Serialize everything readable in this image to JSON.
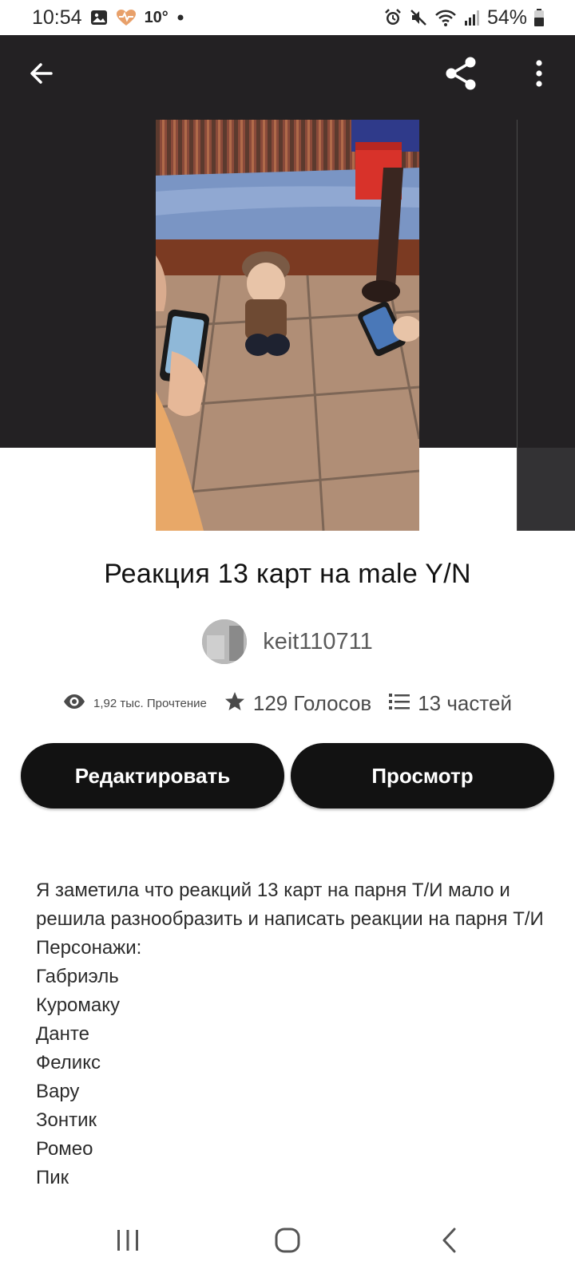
{
  "status_bar": {
    "time": "10:54",
    "temperature": "10°",
    "battery": "54%",
    "icons": [
      "image-icon",
      "health-icon",
      "dot-icon",
      "alarm-icon",
      "mute-icon",
      "wifi-icon",
      "signal-icon",
      "battery-icon"
    ]
  },
  "top_bar": {
    "back_icon": "arrow-left-icon",
    "share_icon": "share-icon",
    "more_icon": "more-vertical-icon"
  },
  "story": {
    "title": "Реакция 13 карт на male Y/N",
    "author": "keit110711",
    "stats": {
      "reads": "1,92 тыс. Прочтение",
      "votes": "129 Голосов",
      "parts": "13 частей"
    }
  },
  "buttons": {
    "edit_label": "Редактировать",
    "view_label": "Просмотр"
  },
  "description": {
    "intro": "Я заметила что реакций 13 карт на парня Т/И мало и решила разнообразить и написать реакции на парня Т/И",
    "lines": [
      "Персонажи:",
      "Габриэль",
      "Куромаку",
      "Данте",
      "Феликс",
      "Вару",
      "Зонтик",
      "Ромео",
      "Пик"
    ]
  },
  "colors": {
    "header_bg": "#232123",
    "button_bg": "#121212",
    "button_text": "#ffffff",
    "text_primary": "#121212",
    "text_secondary": "#5a5a5a"
  },
  "nav_bar": {
    "icons": [
      "recents-icon",
      "home-icon",
      "back-icon"
    ]
  }
}
